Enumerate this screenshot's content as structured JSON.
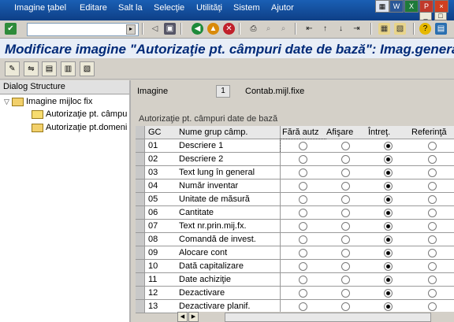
{
  "menubar": {
    "items": [
      "Imagine ţabel",
      "Editare",
      "Salt la",
      "Selecţie",
      "Utilităţi",
      "Sistem",
      "Ajutor"
    ]
  },
  "toolbar": {
    "command_value": ""
  },
  "title": "Modificare imagine \"Autorizaţie pt. câmpuri date de bază\": Imag.genera",
  "dialog": {
    "header": "Dialog Structure",
    "root": "Imagine mijloc fix",
    "items": [
      "Autorizaţie pt. câmpu",
      "Autorizaţie pt.domeni"
    ]
  },
  "main": {
    "imagine_label": "Imagine",
    "imagine_value": "1",
    "imagine_desc": "Contab.mijl.fixe",
    "table_caption": "Autorizaţie pt. câmpuri date de bază",
    "columns": [
      "GC",
      "Nume grup câmp.",
      "Fără autz",
      "Afişare",
      "Întreţ.",
      "Referinţă"
    ],
    "rows": [
      {
        "gc": "01",
        "name": "Descriere 1",
        "sel": 2
      },
      {
        "gc": "02",
        "name": "Descriere 2",
        "sel": 2
      },
      {
        "gc": "03",
        "name": "Text lung în general",
        "sel": 2
      },
      {
        "gc": "04",
        "name": "Număr inventar",
        "sel": 2
      },
      {
        "gc": "05",
        "name": "Unitate de măsură",
        "sel": 2
      },
      {
        "gc": "06",
        "name": "Cantitate",
        "sel": 2
      },
      {
        "gc": "07",
        "name": "Text nr.prin.mij.fx.",
        "sel": 2
      },
      {
        "gc": "08",
        "name": "Comandă de invest.",
        "sel": 2
      },
      {
        "gc": "09",
        "name": "Alocare cont",
        "sel": 2
      },
      {
        "gc": "10",
        "name": "Dată capitalizare",
        "sel": 2
      },
      {
        "gc": "11",
        "name": "Date achiziţie",
        "sel": 2
      },
      {
        "gc": "12",
        "name": "Dezactivare",
        "sel": 2
      },
      {
        "gc": "13",
        "name": "Dezactivare planif.",
        "sel": 2
      }
    ]
  },
  "colors": {
    "menubar": "#1a5fb4",
    "title": "#002a78"
  }
}
